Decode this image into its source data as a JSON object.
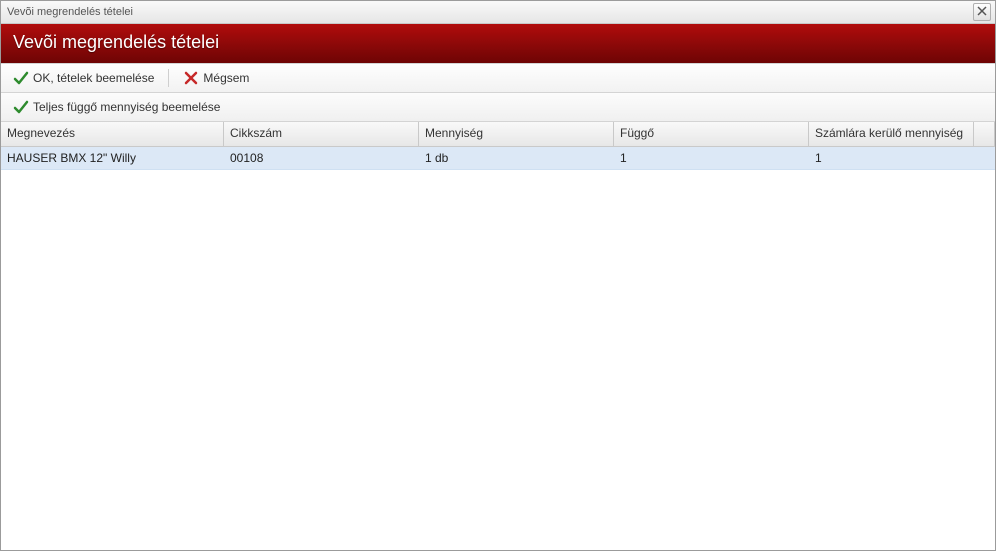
{
  "window": {
    "title": "Vevõi megrendelés tételei",
    "banner_title": "Vevõi megrendelés tételei"
  },
  "toolbar": {
    "ok_label": "OK, tételek beemelése",
    "cancel_label": "Mégsem"
  },
  "subtoolbar": {
    "full_qty_label": "Teljes függő mennyiség beemelése"
  },
  "table": {
    "columns": {
      "name": "Megnevezés",
      "item_no": "Cikkszám",
      "qty": "Mennyiség",
      "pending": "Függő",
      "invoice_qty": "Számlára kerülő mennyiség"
    },
    "rows": [
      {
        "name": "HAUSER BMX 12\" Willy",
        "item_no": "00108",
        "qty": "1 db",
        "pending": "1",
        "invoice_qty": "1"
      }
    ]
  }
}
